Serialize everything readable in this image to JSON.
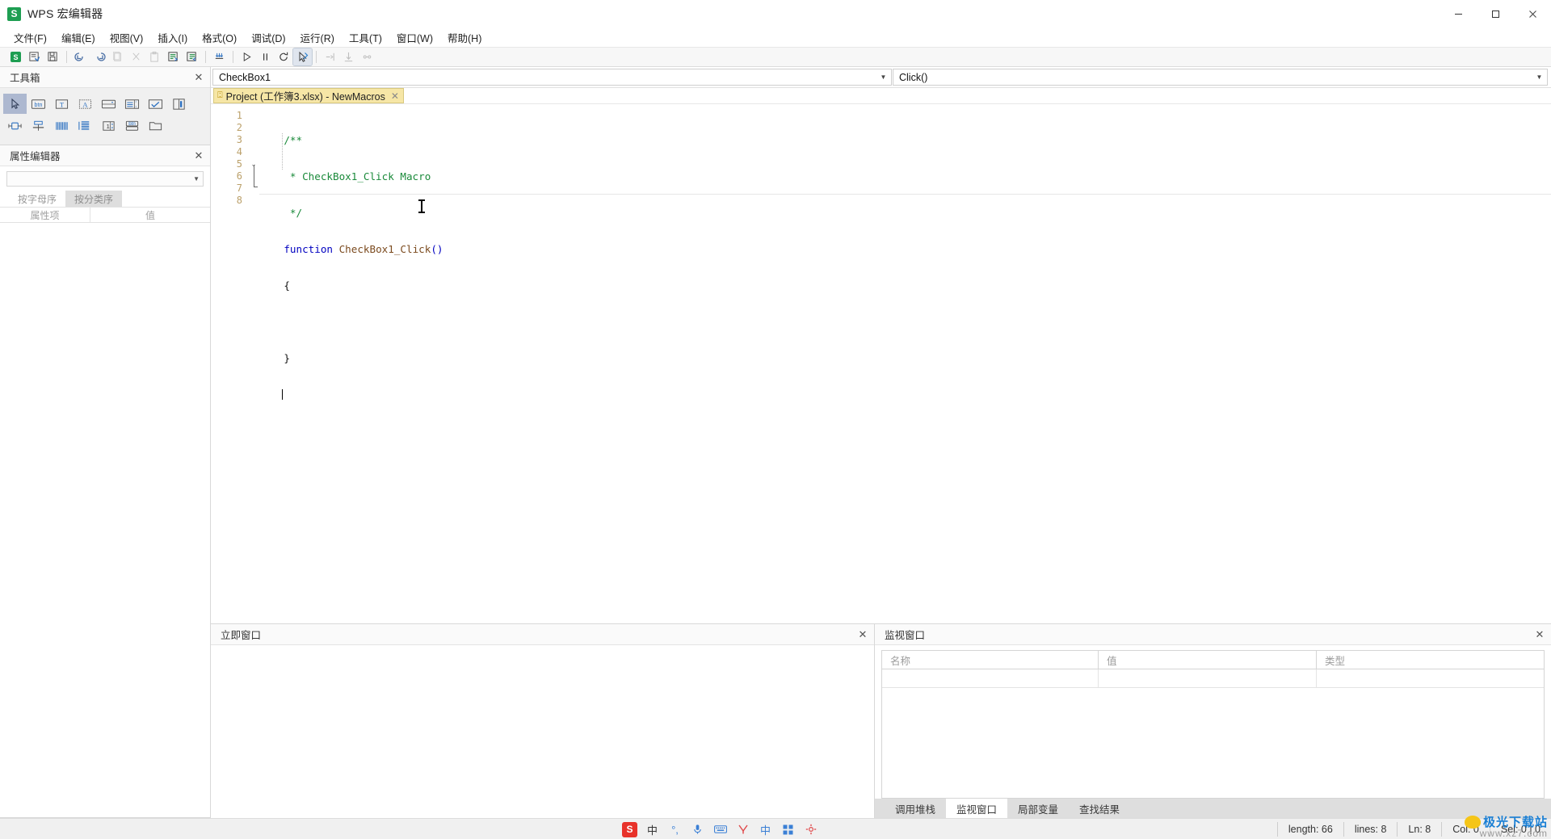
{
  "window": {
    "title": "WPS 宏编辑器",
    "logo_letter": "S",
    "minimize": "─",
    "maximize": "□",
    "close": "✕"
  },
  "menubar": {
    "items": [
      {
        "label": "文件(F)",
        "name": "menu-file"
      },
      {
        "label": "编辑(E)",
        "name": "menu-edit"
      },
      {
        "label": "视图(V)",
        "name": "menu-view"
      },
      {
        "label": "插入(I)",
        "name": "menu-insert"
      },
      {
        "label": "格式(O)",
        "name": "menu-format"
      },
      {
        "label": "调试(D)",
        "name": "menu-debug"
      },
      {
        "label": "运行(R)",
        "name": "menu-run"
      },
      {
        "label": "工具(T)",
        "name": "menu-tools"
      },
      {
        "label": "窗口(W)",
        "name": "menu-window"
      },
      {
        "label": "帮助(H)",
        "name": "menu-help"
      }
    ]
  },
  "toolbar": {
    "buttons": [
      {
        "name": "wps-logo-icon",
        "icon": "wps",
        "state": "normal"
      },
      {
        "name": "save-icon",
        "icon": "save",
        "state": "normal"
      },
      {
        "name": "export-icon",
        "icon": "export",
        "state": "normal"
      },
      {
        "name": "undo-icon",
        "icon": "undo",
        "state": "normal"
      },
      {
        "name": "redo-icon",
        "icon": "redo",
        "state": "normal"
      },
      {
        "name": "copy-icon",
        "icon": "copy",
        "state": "disabled"
      },
      {
        "name": "cut-icon",
        "icon": "cut",
        "state": "disabled"
      },
      {
        "name": "paste-icon",
        "icon": "paste",
        "state": "disabled"
      },
      {
        "name": "indent-icon",
        "icon": "indent",
        "state": "normal"
      },
      {
        "name": "outdent-icon",
        "icon": "outdent",
        "state": "normal"
      },
      {
        "name": "breakpoint-icon",
        "icon": "breakpoint",
        "state": "normal"
      },
      {
        "name": "run-icon",
        "icon": "run",
        "state": "normal"
      },
      {
        "name": "pause-icon",
        "icon": "pause",
        "state": "normal"
      },
      {
        "name": "reset-icon",
        "icon": "reset",
        "state": "normal"
      },
      {
        "name": "design-mode-icon",
        "icon": "design",
        "state": "active"
      },
      {
        "name": "step-into-icon",
        "icon": "stepin",
        "state": "disabled"
      },
      {
        "name": "step-over-icon",
        "icon": "stepover",
        "state": "disabled"
      },
      {
        "name": "step-out-icon",
        "icon": "stepout",
        "state": "disabled"
      }
    ]
  },
  "toolbox": {
    "title": "工具箱",
    "close": "✕",
    "tools": [
      {
        "name": "tool-select-pointer",
        "icon": "pointer",
        "selected": true
      },
      {
        "name": "tool-command-button",
        "icon": "btn",
        "selected": false
      },
      {
        "name": "tool-textbox",
        "icon": "T",
        "selected": false
      },
      {
        "name": "tool-label",
        "icon": "A",
        "selected": false
      },
      {
        "name": "tool-combobox",
        "icon": "combo",
        "selected": false
      },
      {
        "name": "tool-listbox",
        "icon": "list",
        "selected": false
      },
      {
        "name": "tool-checkbox",
        "icon": "check",
        "selected": false
      },
      {
        "name": "tool-toggle-button",
        "icon": "toggle",
        "selected": false
      },
      {
        "name": "tool-option-button",
        "icon": "option",
        "selected": false
      },
      {
        "name": "tool-frame",
        "icon": "frame",
        "selected": false
      },
      {
        "name": "tool-scrollbar-h",
        "icon": "scrollh",
        "selected": false
      },
      {
        "name": "tool-scrollbar-v",
        "icon": "scrollv",
        "selected": false
      },
      {
        "name": "tool-spinbutton",
        "icon": "spin",
        "selected": false
      },
      {
        "name": "tool-multipage",
        "icon": "multipage",
        "selected": false
      },
      {
        "name": "tool-image",
        "icon": "image",
        "selected": false
      }
    ]
  },
  "property_editor": {
    "title": "属性编辑器",
    "close": "✕",
    "combo_value": "",
    "combo_arrow": "▼",
    "tabs": [
      {
        "label": "按字母序",
        "name": "tab-alphabetic",
        "active": true
      },
      {
        "label": "按分类序",
        "name": "tab-categorized",
        "active": false
      }
    ],
    "columns": [
      "属性项",
      "值"
    ],
    "rows": []
  },
  "object_combo": {
    "value": "CheckBox1",
    "arrow": "▼"
  },
  "procedure_combo": {
    "value": "Click()",
    "arrow": "▼"
  },
  "editor_tab": {
    "icon": "⍠",
    "label": "Project (工作簿3.xlsx) - NewMacros",
    "close": "✕"
  },
  "code": {
    "line_numbers": [
      "1",
      "2",
      "3",
      "4",
      "5",
      "6",
      "7",
      "8"
    ],
    "fold_marker": "⌄",
    "lines": [
      {
        "n": 1,
        "tokens": [
          {
            "t": "    /**",
            "c": "k-green"
          }
        ]
      },
      {
        "n": 2,
        "tokens": [
          {
            "t": "     * CheckBox1_Click Macro",
            "c": "k-green"
          }
        ]
      },
      {
        "n": 3,
        "tokens": [
          {
            "t": "     */",
            "c": "k-green"
          }
        ]
      },
      {
        "n": 4,
        "tokens": [
          {
            "t": "    function ",
            "c": "k-blue"
          },
          {
            "t": "CheckBox1_Click",
            "c": "k-brown"
          },
          {
            "t": "()",
            "c": "k-blue"
          }
        ]
      },
      {
        "n": 5,
        "tokens": [
          {
            "t": "    {",
            "c": "k-black"
          }
        ]
      },
      {
        "n": 6,
        "tokens": [
          {
            "t": "",
            "c": "k-black"
          }
        ]
      },
      {
        "n": 7,
        "tokens": [
          {
            "t": "    }",
            "c": "k-black"
          }
        ]
      },
      {
        "n": 8,
        "tokens": [
          {
            "t": "",
            "c": "k-black"
          }
        ]
      }
    ]
  },
  "immediate_window": {
    "title": "立即窗口",
    "close": "✕"
  },
  "watch_window": {
    "title": "监视窗口",
    "close": "✕",
    "columns": [
      "名称",
      "值",
      "类型"
    ],
    "rows": [
      [
        "",
        "",
        ""
      ]
    ],
    "tabs": [
      {
        "label": "调用堆栈",
        "name": "tab-call-stack",
        "active": false
      },
      {
        "label": "监视窗口",
        "name": "tab-watch",
        "active": true
      },
      {
        "label": "局部变量",
        "name": "tab-locals",
        "active": false
      },
      {
        "label": "查找结果",
        "name": "tab-find-results",
        "active": false
      }
    ]
  },
  "statusbar": {
    "length": "length: 66",
    "lines": "lines: 8",
    "ln": "Ln: 8",
    "col": "Col: 0",
    "sel": "Sel: 0 | 0",
    "tray": {
      "sogou": "S",
      "chinese": "中",
      "punct": "°,",
      "mic": "🎙",
      "keyboard": "⌨",
      "tools": "✂",
      "web": "中",
      "apps": "▦",
      "settings": "⚙"
    },
    "watermark_top": "极光下载站",
    "watermark_bottom": "www.xz7.com"
  }
}
